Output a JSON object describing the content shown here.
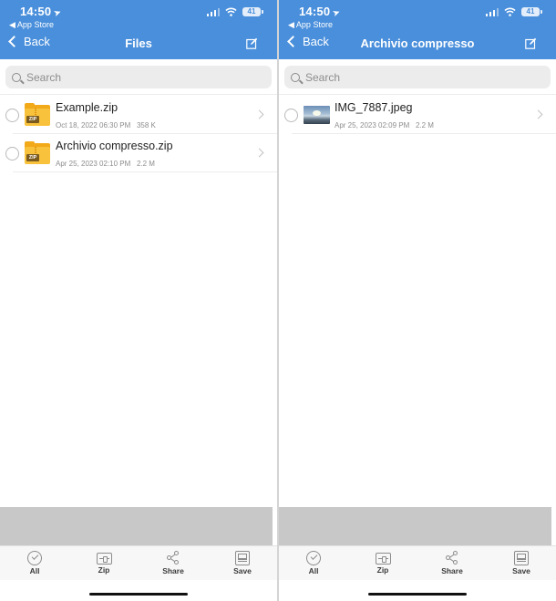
{
  "status_bar": {
    "time": "14:50",
    "back_app": "◀ App Store",
    "battery": "41"
  },
  "left_screen": {
    "nav": {
      "back_label": "Back",
      "title": "Files"
    },
    "search": {
      "placeholder": "Search"
    },
    "files": [
      {
        "name": "Example.zip",
        "date": "Oct 18, 2022 06:30 PM",
        "size": "358 K",
        "type": "zip",
        "icon_label": "ZIP"
      },
      {
        "name": "Archivio compresso.zip",
        "date": "Apr 25, 2023 02:10 PM",
        "size": "2.2 M",
        "type": "zip",
        "icon_label": "ZIP"
      }
    ]
  },
  "right_screen": {
    "nav": {
      "back_label": "Back",
      "title": "Archivio compresso"
    },
    "search": {
      "placeholder": "Search"
    },
    "files": [
      {
        "name": "IMG_7887.jpeg",
        "date": "Apr 25, 2023 02:09 PM",
        "size": "2.2 M",
        "type": "image"
      }
    ]
  },
  "toolbar": {
    "all_label": "All",
    "zip_label": "Zip",
    "share_label": "Share",
    "save_label": "Save"
  },
  "colors": {
    "header": "#4a8fdb",
    "folder": "#f9c23c",
    "ad_placeholder": "#c8c8c8"
  },
  "icons": [
    "location-arrow-icon",
    "signal-icon",
    "wifi-icon",
    "battery-icon",
    "chevron-left-icon",
    "edit-icon",
    "search-icon",
    "zip-folder-icon",
    "image-thumbnail",
    "chevron-right-icon",
    "check-circle-icon",
    "zip-icon",
    "share-icon",
    "save-icon"
  ]
}
